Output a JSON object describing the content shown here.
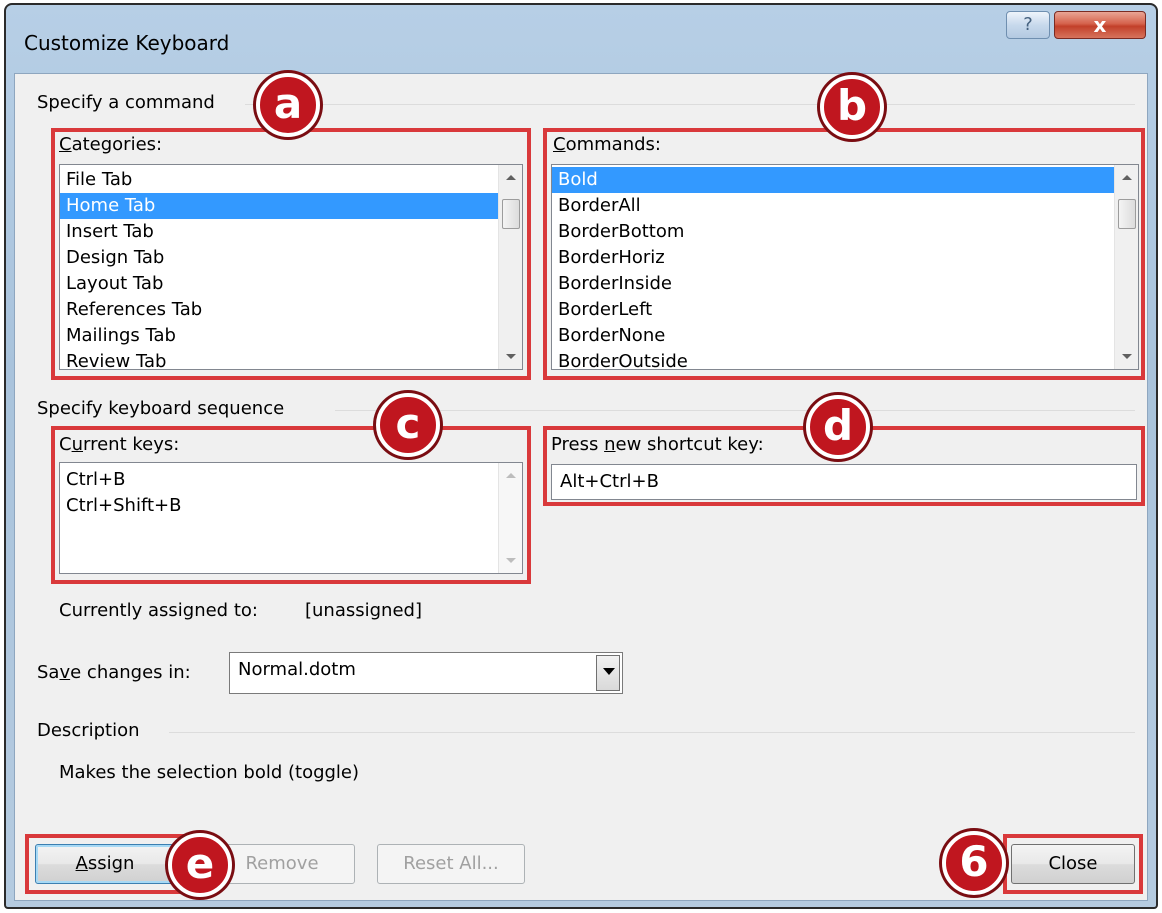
{
  "window": {
    "title": "Customize Keyboard",
    "help_glyph": "?",
    "close_glyph": "x"
  },
  "specify_command": {
    "group_label": "Specify a command",
    "categories": {
      "label_u": "C",
      "label_rest": "ategories:",
      "items": [
        "File Tab",
        "Home Tab",
        "Insert Tab",
        "Design Tab",
        "Layout Tab",
        "References Tab",
        "Mailings Tab",
        "Review Tab"
      ],
      "selected": "Home Tab"
    },
    "commands": {
      "label_u": "C",
      "label_rest": "ommands:",
      "items": [
        "Bold",
        "BorderAll",
        "BorderBottom",
        "BorderHoriz",
        "BorderInside",
        "BorderLeft",
        "BorderNone",
        "BorderOutside"
      ],
      "selected": "Bold"
    }
  },
  "keyboard_sequence": {
    "group_label": "Specify keyboard sequence",
    "current_keys": {
      "label_pre": "C",
      "label_u": "u",
      "label_rest": "rrent keys:",
      "items": [
        "Ctrl+B",
        "Ctrl+Shift+B"
      ]
    },
    "new_key": {
      "label_pre": "Press ",
      "label_u": "n",
      "label_rest": "ew shortcut key:",
      "value": "Alt+Ctrl+B"
    },
    "assigned": {
      "label": "Currently assigned to:",
      "value": "[unassigned]"
    }
  },
  "save_changes": {
    "label_pre": "Sa",
    "label_u": "v",
    "label_rest": "e changes in:",
    "value": "Normal.dotm"
  },
  "description": {
    "group_label": "Description",
    "text": "Makes the selection bold (toggle)"
  },
  "buttons": {
    "assign_u": "A",
    "assign_rest": "ssign",
    "remove": "Remove",
    "reset_all": "Reset All...",
    "close": "Close"
  },
  "annotations": {
    "a": "a",
    "b": "b",
    "c": "c",
    "d": "d",
    "e": "e",
    "six": "6"
  },
  "colors": {
    "annotation_red": "#d9393b",
    "badge_red": "#c0161f",
    "selection_blue": "#3399ff"
  }
}
